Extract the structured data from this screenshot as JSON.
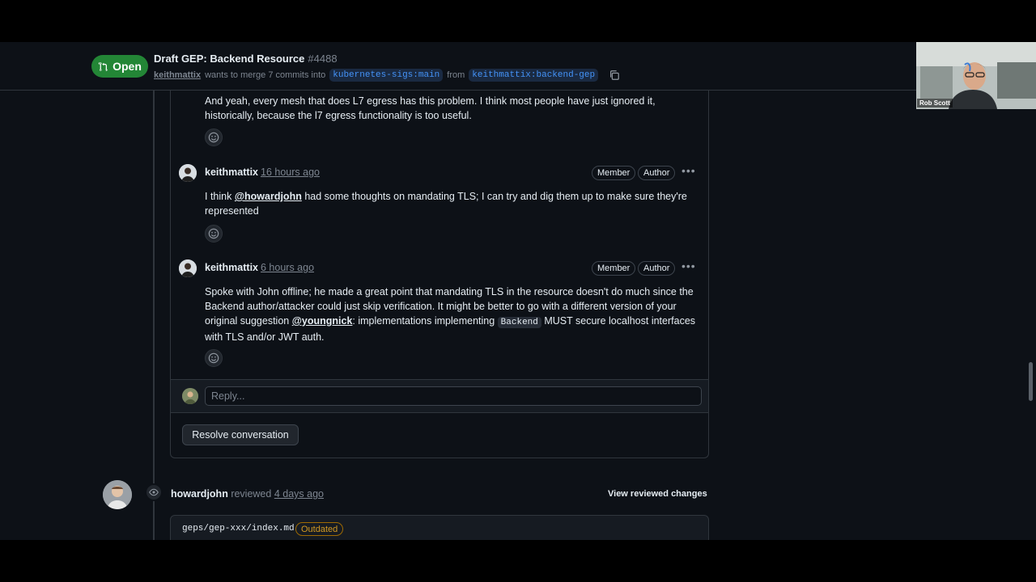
{
  "header": {
    "status_label": "Open",
    "title": "Draft GEP: Backend Resource",
    "number": "#4488",
    "author": "keithmattix",
    "merge_text": "wants to merge 7 commits into",
    "base_branch": "kubernetes-sigs:main",
    "from_text": "from",
    "head_branch": "keithmattix:backend-gep"
  },
  "comments": [
    {
      "text": "And yeah, every mesh that does L7 egress has this problem. I think most people have just ignored it, historically, because the l7 egress functionality is too useful."
    },
    {
      "user": "keithmattix",
      "time": "16 hours ago",
      "badges": [
        "Member",
        "Author"
      ],
      "text_before": "I think ",
      "mention": "@howardjohn",
      "text_after": " had some thoughts on mandating TLS; I can try and dig them up to make sure they're represented"
    },
    {
      "user": "keithmattix",
      "time": "6 hours ago",
      "badges": [
        "Member",
        "Author"
      ],
      "text_1": "Spoke with John offline; he made a great point that mandating TLS in the resource doesn't do much since the Backend author/attacker could just skip verification. It might be better to go with a different version of your original suggestion ",
      "mention": "@youngnick",
      "text_2": ": implementations implementing ",
      "code": "Backend",
      "text_3": " MUST secure localhost interfaces with TLS and/or JWT auth."
    }
  ],
  "reply": {
    "placeholder": "Reply..."
  },
  "resolve_label": "Resolve conversation",
  "review": {
    "user": "howardjohn",
    "action": "reviewed",
    "time": "4 days ago",
    "view_label": "View reviewed changes"
  },
  "file": {
    "path": "geps/gep-xxx/index.md",
    "badge": "Outdated"
  },
  "webcam": {
    "name": "Rob Scott"
  },
  "colors": {
    "open_green": "#238636",
    "link_blue": "#4493f8",
    "outdated_orange": "#d29922"
  }
}
